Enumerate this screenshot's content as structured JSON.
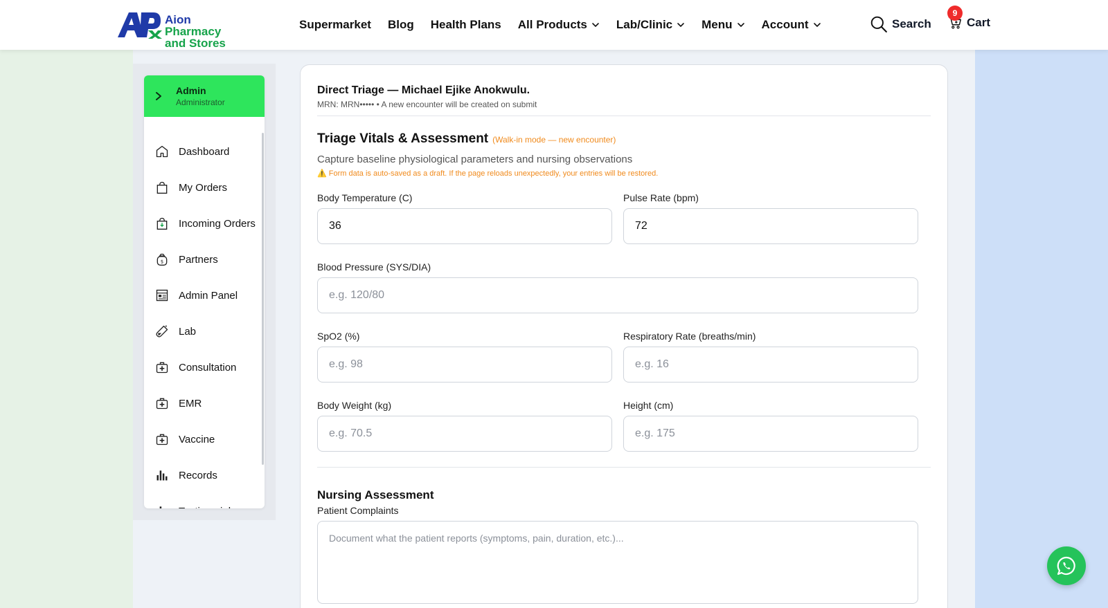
{
  "brand": {
    "line1_a": "Aion ",
    "line1_b": "Pharmacy",
    "line2": "and Stores"
  },
  "nav": {
    "items": [
      {
        "label": "Supermarket",
        "dropdown": false
      },
      {
        "label": "Blog",
        "dropdown": false
      },
      {
        "label": "Health Plans",
        "dropdown": false
      },
      {
        "label": "All Products",
        "dropdown": true
      },
      {
        "label": "Lab/Clinic",
        "dropdown": true
      },
      {
        "label": "Menu",
        "dropdown": true
      },
      {
        "label": "Account",
        "dropdown": true
      }
    ],
    "search_label": "Search",
    "cart_label": "Cart",
    "cart_count": "9"
  },
  "sidebar": {
    "user_name": "Admin",
    "user_role": "Administrator",
    "items": [
      {
        "label": "Dashboard",
        "icon": "home-icon"
      },
      {
        "label": "My Orders",
        "icon": "shopping-bag-icon"
      },
      {
        "label": "Incoming Orders",
        "icon": "incoming-bag-icon"
      },
      {
        "label": "Partners",
        "icon": "money-bag-icon"
      },
      {
        "label": "Admin Panel",
        "icon": "panel-icon"
      },
      {
        "label": "Lab",
        "icon": "test-tube-icon"
      },
      {
        "label": "Consultation",
        "icon": "medical-kit-icon"
      },
      {
        "label": "EMR",
        "icon": "medical-kit-icon"
      },
      {
        "label": "Vaccine",
        "icon": "medical-kit-icon"
      },
      {
        "label": "Records",
        "icon": "bar-chart-icon"
      },
      {
        "label": "Testimonials",
        "icon": "bar-chart-icon"
      }
    ]
  },
  "main": {
    "triage_title": "Direct Triage — Michael Ejike Anokwulu.",
    "triage_sub": "MRN: MRN••••• • A new encounter will be created on submit",
    "section_title": "Triage Vitals & Assessment",
    "section_mode": "(Walk-in mode — new encounter)",
    "section_desc": "Capture baseline physiological parameters and nursing observations",
    "section_warn": "Form data is auto-saved as a draft. If the page reloads unexpectedly, your entries will be restored.",
    "fields": {
      "temp": {
        "label": "Body Temperature (C)",
        "value": "36",
        "placeholder": ""
      },
      "pulse": {
        "label": "Pulse Rate (bpm)",
        "value": "72",
        "placeholder": ""
      },
      "bp": {
        "label": "Blood Pressure (SYS/DIA)",
        "value": "",
        "placeholder": "e.g. 120/80"
      },
      "spo2": {
        "label": "SpO2 (%)",
        "value": "",
        "placeholder": "e.g. 98"
      },
      "resp": {
        "label": "Respiratory Rate (breaths/min)",
        "value": "",
        "placeholder": "e.g. 16"
      },
      "weight": {
        "label": "Body Weight (kg)",
        "value": "",
        "placeholder": "e.g. 70.5"
      },
      "height": {
        "label": "Height (cm)",
        "value": "",
        "placeholder": "e.g. 175"
      }
    },
    "nursing_title": "Nursing Assessment",
    "complaints_label": "Patient Complaints",
    "complaints_placeholder": "Document what the patient reports (symptoms, pain, duration, etc.)..."
  },
  "colors": {
    "accent_green": "#2ee55c",
    "brand_blue": "#1f3aa8",
    "warn_orange": "#f08a1c",
    "badge_red": "#ef2b2b",
    "whatsapp_green": "#25c35a"
  }
}
